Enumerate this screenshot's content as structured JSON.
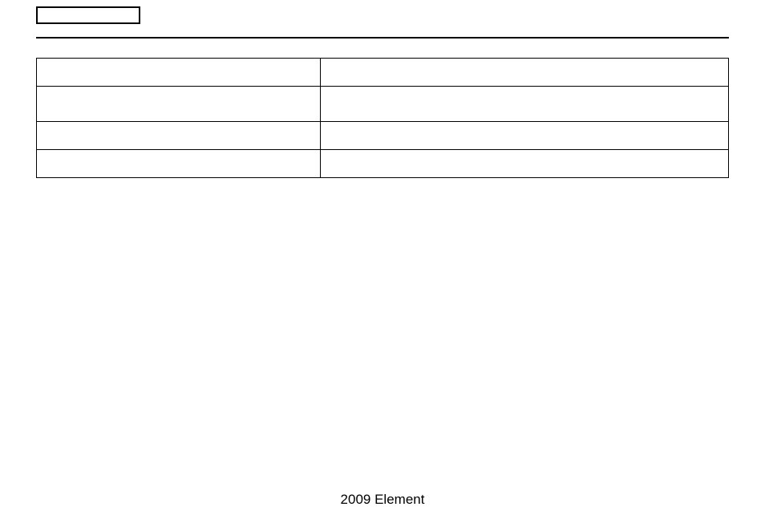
{
  "top_box": "",
  "table": {
    "rows": [
      {
        "left": "",
        "right": ""
      },
      {
        "left": "",
        "right": ""
      },
      {
        "left": "",
        "right": ""
      },
      {
        "left": "",
        "right": ""
      }
    ]
  },
  "footer": "2009  Element"
}
